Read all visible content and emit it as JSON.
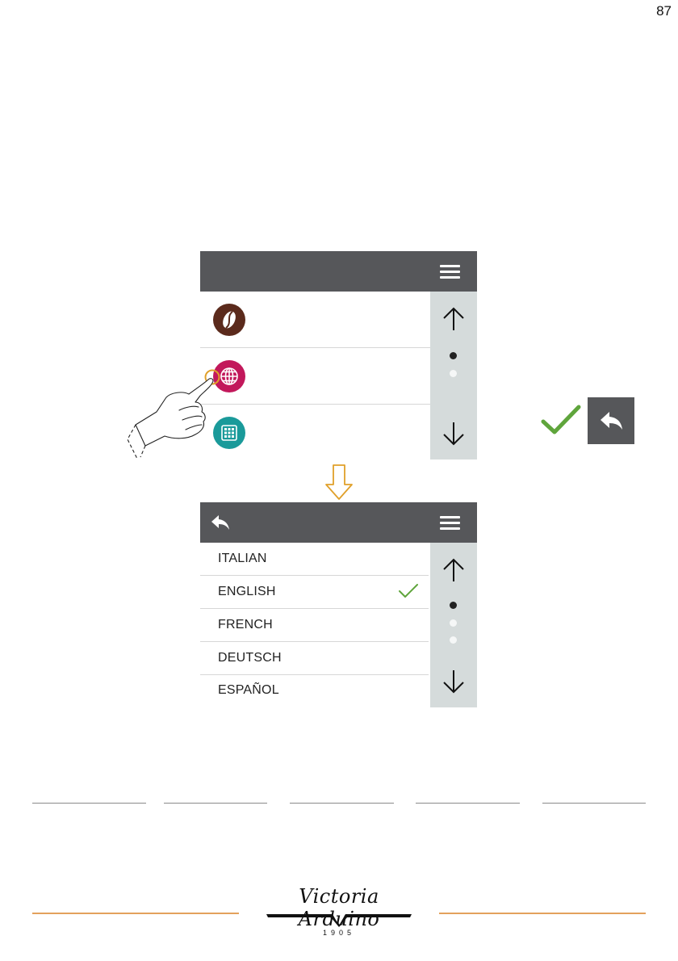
{
  "page": {
    "number": "87"
  },
  "screen1": {
    "menu_rows": [
      {
        "icon": "coffee-bean-icon",
        "color": "#5b2a1c"
      },
      {
        "icon": "globe-icon",
        "color": "#c2185b"
      },
      {
        "icon": "keypad-icon",
        "color": "#1a9a9a"
      }
    ],
    "scroll": {
      "dots": 2,
      "active_dot": 1
    }
  },
  "screen2": {
    "languages": [
      {
        "label": "ITALIAN",
        "selected": false
      },
      {
        "label": "ENGLISH",
        "selected": true
      },
      {
        "label": "FRENCH",
        "selected": false
      },
      {
        "label": "DEUTSCH",
        "selected": false
      },
      {
        "label": "ESPAÑOL",
        "selected": false
      }
    ],
    "scroll": {
      "dots": 3,
      "active_dot": 1
    }
  },
  "legend": {
    "icons": [
      "check-icon",
      "back-icon"
    ]
  },
  "footer": {
    "logo_text": "Victoria Arduino",
    "logo_year": "1905"
  },
  "colors": {
    "topbar": "#56575a",
    "scrollbar": "#d5dbdb",
    "check_green": "#5fa53c",
    "arrow_orange": "#e0a02a",
    "rule_orange": "#e3a15c"
  }
}
